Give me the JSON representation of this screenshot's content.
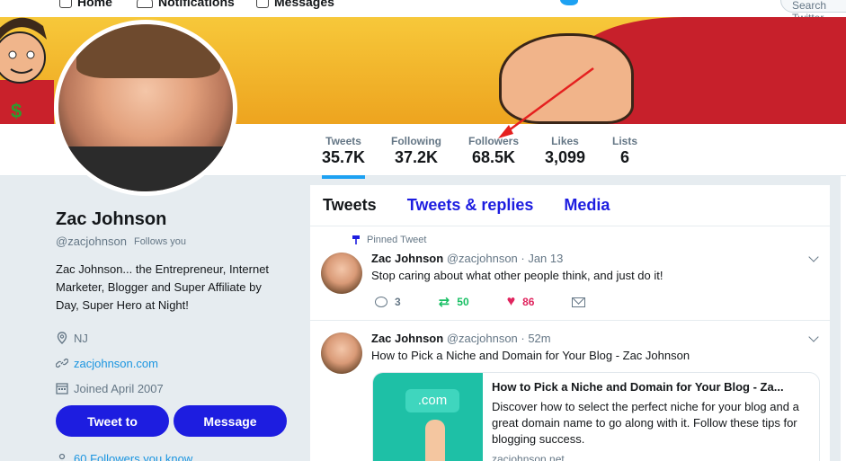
{
  "topnav": {
    "home_label": "Home",
    "notifications_label": "Notifications",
    "messages_label": "Messages",
    "search_placeholder": "Search Twitter"
  },
  "stats": [
    {
      "label": "Tweets",
      "value": "35.7K"
    },
    {
      "label": "Following",
      "value": "37.2K"
    },
    {
      "label": "Followers",
      "value": "68.5K"
    },
    {
      "label": "Likes",
      "value": "3,099"
    },
    {
      "label": "Lists",
      "value": "6"
    }
  ],
  "profile": {
    "name": "Zac Johnson",
    "handle": "@zacjohnson",
    "follows_you": "Follows you",
    "bio": "Zac Johnson... the Entrepreneur, Internet Marketer, Blogger and Super Affiliate by Day, Super Hero at Night!",
    "location": "NJ",
    "website": "zacjohnson.com",
    "joined": "Joined April 2007",
    "followers_you_know": "60 Followers you know",
    "tweet_to_label": "Tweet to",
    "message_label": "Message"
  },
  "timeline": {
    "tabs": [
      "Tweets",
      "Tweets & replies",
      "Media"
    ],
    "tweets": [
      {
        "pinned_label": "Pinned Tweet",
        "name": "Zac Johnson",
        "handle_time": "@zacjohnson · Jan 13",
        "text": "Stop caring about what other people think, and just do it!",
        "replies": "3",
        "retweets": "50",
        "likes": "86"
      },
      {
        "name": "Zac Johnson",
        "handle_time": "@zacjohnson · 52m",
        "text": "How to Pick a Niche and Domain for Your Blog - Zac Johnson",
        "card": {
          "image_text": ".com",
          "title": "How to Pick a Niche and Domain for Your Blog - Za...",
          "description": "Discover how to select the perfect niche for your blog and a great domain name to go along with it. Follow these tips for blogging success.",
          "url": "zacjohnson.net"
        }
      }
    ]
  },
  "colors": {
    "brand_blue": "#1d1de0",
    "link_blue": "#1b95e0",
    "retweet_green": "#17bf63",
    "like_red": "#e0245e",
    "arrow_red": "#e5201f"
  }
}
